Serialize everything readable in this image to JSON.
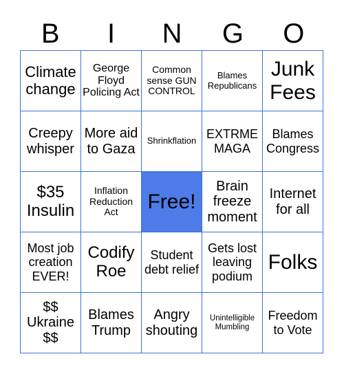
{
  "header": [
    "B",
    "I",
    "N",
    "G",
    "O"
  ],
  "colors": {
    "grid_line": "#3d72dc",
    "free_cell": "#4d7ce8"
  },
  "cells": [
    [
      "Climate change",
      "George Floyd Policing Act",
      "Common sense GUN CONTROL",
      "Blames Republicans",
      "Junk Fees"
    ],
    [
      "Creepy whisper",
      "More aid to Gaza",
      "Shrinkflation",
      "EXTRME MAGA",
      "Blames Congress"
    ],
    [
      "$35 Insulin",
      "Inflation Reduction Act",
      "Free!",
      "Brain freeze moment",
      "Internet for all"
    ],
    [
      "Most job creation EVER!",
      "Codify Roe",
      "Student debt relief",
      "Gets lost leaving podium",
      "Folks"
    ],
    [
      "$$ Ukraine $$",
      "Blames Trump",
      "Angry shouting",
      "Unintelligible Mumbling",
      "Freedom to Vote"
    ]
  ]
}
